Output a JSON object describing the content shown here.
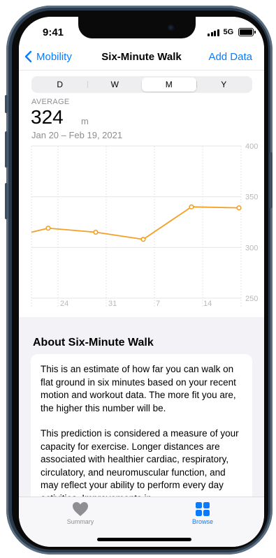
{
  "status_bar": {
    "time": "9:41",
    "network": "5G",
    "icons": [
      "cellular-signal-icon",
      "battery-icon"
    ]
  },
  "nav": {
    "back_label": "Mobility",
    "title": "Six-Minute Walk",
    "action_label": "Add Data"
  },
  "range_selector": {
    "options": [
      "D",
      "W",
      "M",
      "Y"
    ],
    "selected": "M"
  },
  "summary": {
    "label": "AVERAGE",
    "value": "324",
    "unit": "m",
    "date_range": "Jan 20 – Feb 19, 2021"
  },
  "chart_data": {
    "type": "line",
    "x": [
      "Jan 20",
      "Jan 22",
      "Jan 31",
      "Feb 5",
      "Feb 12",
      "Feb 19"
    ],
    "x_tick_labels": [
      "24",
      "31",
      "7",
      "14"
    ],
    "series": [
      {
        "values": [
          315,
          319,
          315,
          308,
          340,
          339
        ]
      }
    ],
    "ylim": [
      250,
      400
    ],
    "y_tick_labels": [
      "400",
      "350",
      "300",
      "250"
    ],
    "grid": true,
    "color": "#f4a024"
  },
  "about": {
    "title": "About Six-Minute Walk",
    "paragraph1": "This is an estimate of how far you can walk on flat ground in six minutes based on your recent motion and workout data. The more fit you are, the higher this number will be.",
    "paragraph2": "This prediction is considered a measure of your capacity for exercise. Longer distances are associated with healthier cardiac, respiratory, circulatory, and neuromuscular function, and may reflect your ability to perform every day activities. Improvements in"
  },
  "tab_bar": {
    "items": [
      {
        "label": "Summary",
        "icon": "heart-icon",
        "active": false
      },
      {
        "label": "Browse",
        "icon": "grid-icon",
        "active": true
      }
    ],
    "active_color": "#0a7aff",
    "inactive_color": "#8e8e93"
  }
}
